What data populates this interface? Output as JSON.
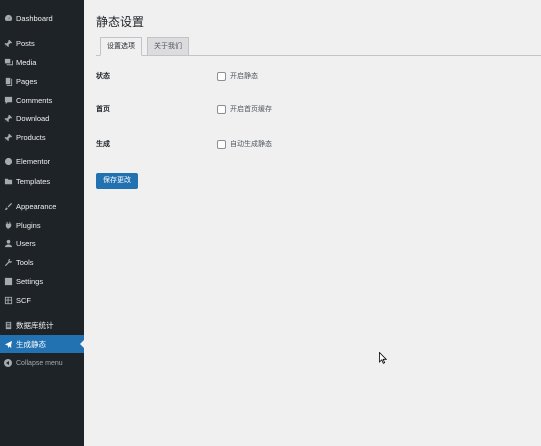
{
  "sidebar": {
    "items": [
      {
        "label": "Dashboard",
        "icon": "dashboard-icon"
      },
      {
        "label": "Posts",
        "icon": "pin-icon"
      },
      {
        "label": "Media",
        "icon": "media-icon"
      },
      {
        "label": "Pages",
        "icon": "pages-icon"
      },
      {
        "label": "Comments",
        "icon": "comment-icon"
      },
      {
        "label": "Download",
        "icon": "pin-icon"
      },
      {
        "label": "Products",
        "icon": "pin-icon"
      },
      {
        "label": "Elementor",
        "icon": "elementor-icon"
      },
      {
        "label": "Templates",
        "icon": "folder-icon"
      },
      {
        "label": "Appearance",
        "icon": "brush-icon"
      },
      {
        "label": "Plugins",
        "icon": "plug-icon"
      },
      {
        "label": "Users",
        "icon": "user-icon"
      },
      {
        "label": "Tools",
        "icon": "wrench-icon"
      },
      {
        "label": "Settings",
        "icon": "settings-icon"
      },
      {
        "label": "SCF",
        "icon": "grid-icon"
      },
      {
        "label": "数据库统计",
        "icon": "database-icon"
      },
      {
        "label": "生成静态",
        "icon": "plane-icon"
      },
      {
        "label": "Collapse menu",
        "icon": "collapse-icon"
      }
    ],
    "active_index": 16
  },
  "page": {
    "title": "静态设置",
    "tabs": [
      {
        "label": "设置选项",
        "active": true
      },
      {
        "label": "关于我们",
        "active": false
      }
    ],
    "settings": [
      {
        "label": "状态",
        "checkbox_label": "开启静态",
        "checked": false
      },
      {
        "label": "首页",
        "checkbox_label": "开启首页缓存",
        "checked": false
      },
      {
        "label": "生成",
        "checkbox_label": "自动生成静态",
        "checked": false
      }
    ],
    "save_label": "保存更改"
  },
  "colors": {
    "sidebar_bg": "#1d2327",
    "accent": "#2271b1",
    "page_bg": "#f0f0f1"
  }
}
